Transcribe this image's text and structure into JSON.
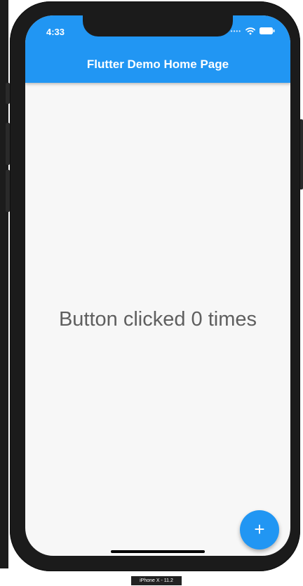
{
  "status_bar": {
    "time": "4:33",
    "signal_icon": "signal-icon",
    "wifi_icon": "wifi-icon",
    "battery_icon": "battery-icon"
  },
  "app_bar": {
    "title": "Flutter Demo Home Page",
    "color": "#2196F3"
  },
  "body": {
    "counter_text": "Button clicked 0 times"
  },
  "fab": {
    "label": "+",
    "icon": "plus-icon",
    "color": "#2196F3"
  },
  "device": {
    "label": "iPhone X - 11.2"
  }
}
